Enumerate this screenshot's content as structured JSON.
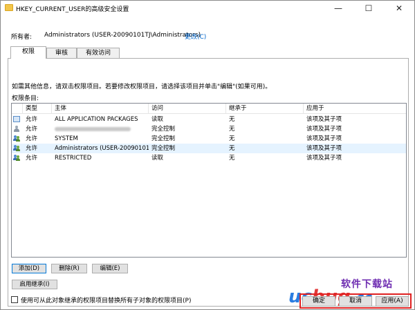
{
  "window": {
    "title": "HKEY_CURRENT_USER的高级安全设置",
    "minimize": "—",
    "maximize": "☐",
    "close": "✕"
  },
  "owner": {
    "label": "所有者:",
    "value": "Administrators (USER-20090101TJ\\Administrators)",
    "change_link": "更改(C)"
  },
  "tabs": [
    {
      "label": "权限",
      "active": true
    },
    {
      "label": "审核",
      "active": false
    },
    {
      "label": "有效访问",
      "active": false
    }
  ],
  "permissions": {
    "hint": "如需其他信息，请双击权限项目。若要修改权限项目，请选择该项目并单击\"编辑\"(如果可用)。",
    "entries_label": "权限条目:",
    "columns": [
      "类型",
      "主体",
      "访问",
      "继承于",
      "应用于"
    ],
    "rows": [
      {
        "icon": "package-icon",
        "type": "允许",
        "principal": "ALL APPLICATION PACKAGES",
        "access": "读取",
        "inherited": "无",
        "applies": "该项及其子项",
        "selected": false,
        "blurred": false
      },
      {
        "icon": "user-icon",
        "type": "允许",
        "principal": "",
        "access": "完全控制",
        "inherited": "无",
        "applies": "该项及其子项",
        "selected": false,
        "blurred": true
      },
      {
        "icon": "users-icon",
        "type": "允许",
        "principal": "SYSTEM",
        "access": "完全控制",
        "inherited": "无",
        "applies": "该项及其子项",
        "selected": false,
        "blurred": false
      },
      {
        "icon": "users-icon",
        "type": "允许",
        "principal": "Administrators (USER-20090101...",
        "access": "完全控制",
        "inherited": "无",
        "applies": "该项及其子项",
        "selected": true,
        "blurred": false
      },
      {
        "icon": "users-icon",
        "type": "允许",
        "principal": "RESTRICTED",
        "access": "读取",
        "inherited": "无",
        "applies": "该项及其子项",
        "selected": false,
        "blurred": false
      }
    ]
  },
  "buttons": {
    "add": "添加(D)",
    "remove": "删除(R)",
    "edit": "编辑(E)",
    "enable_inheritance": "启用继承(I)",
    "replace_checkbox_label": "使用可从此对象继承的权限项目替换所有子对象的权限项目(P)",
    "replace_checked": false,
    "ok": "确定",
    "cancel": "取消",
    "apply": "应用(A)"
  },
  "watermark": {
    "cn": "软件下载站",
    "uc": "uc",
    "bug": "bug",
    "cc": ".cc"
  },
  "colors": {
    "highlight": "#e02020",
    "link": "#0066cc",
    "selected_row": "#e5f3ff"
  }
}
